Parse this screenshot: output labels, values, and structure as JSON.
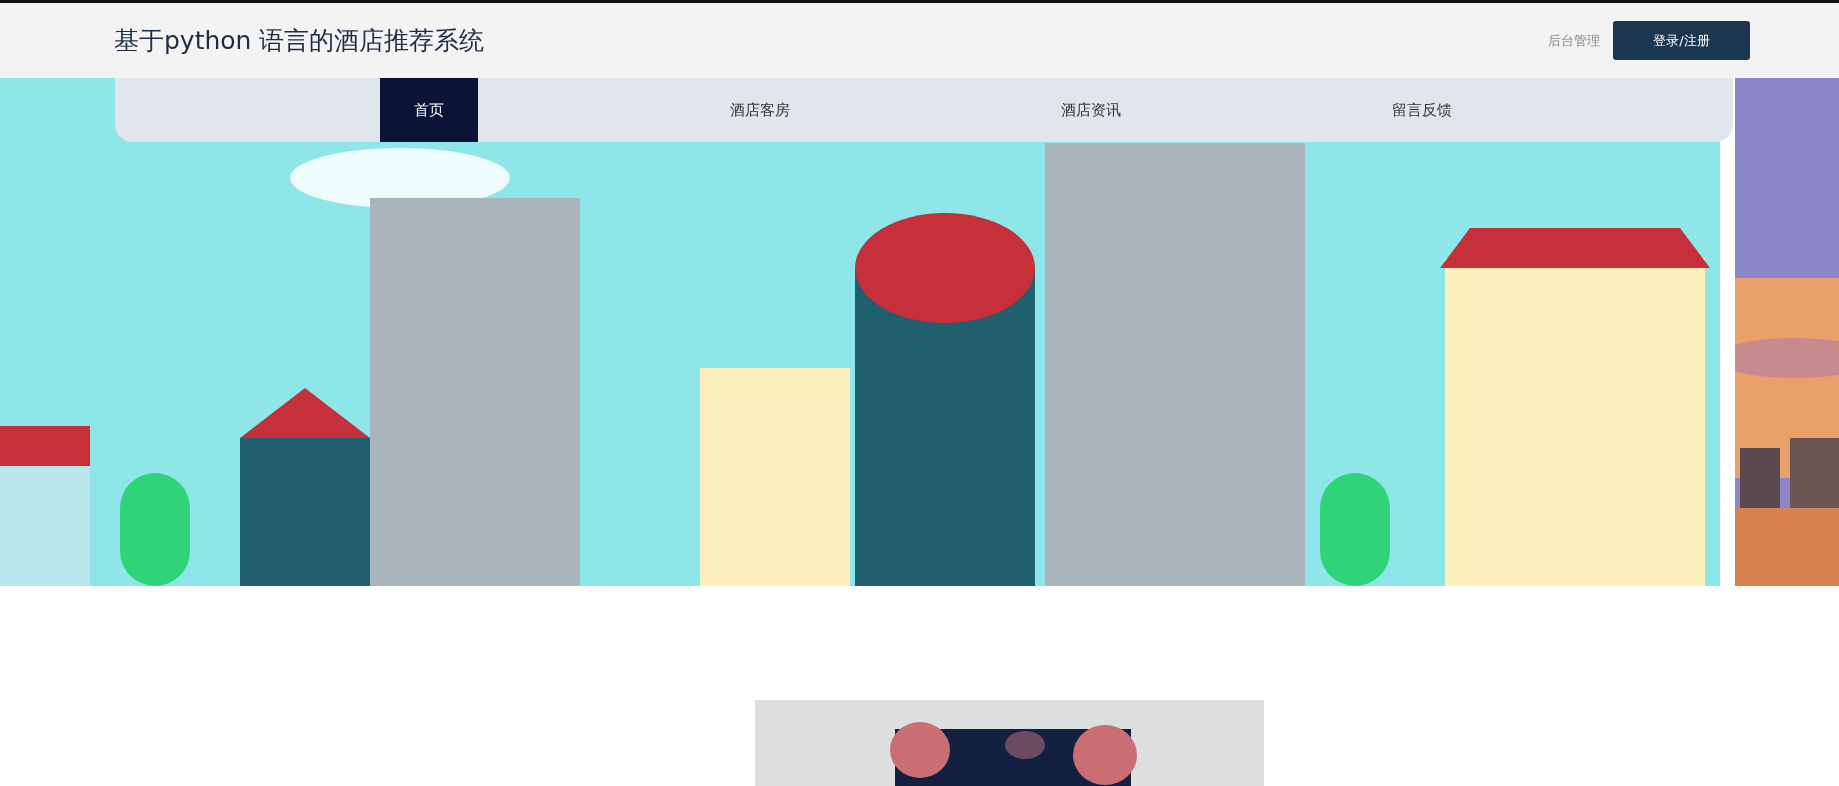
{
  "header": {
    "title": "基于python 语言的酒店推荐系统",
    "admin_link": "后台管理",
    "login_button": "登录/注册"
  },
  "nav": [
    {
      "label": "首页",
      "selected": true
    },
    {
      "label": "酒店客房",
      "selected": false
    },
    {
      "label": "酒店资讯",
      "selected": false
    },
    {
      "label": "留言反馈",
      "selected": false
    }
  ]
}
